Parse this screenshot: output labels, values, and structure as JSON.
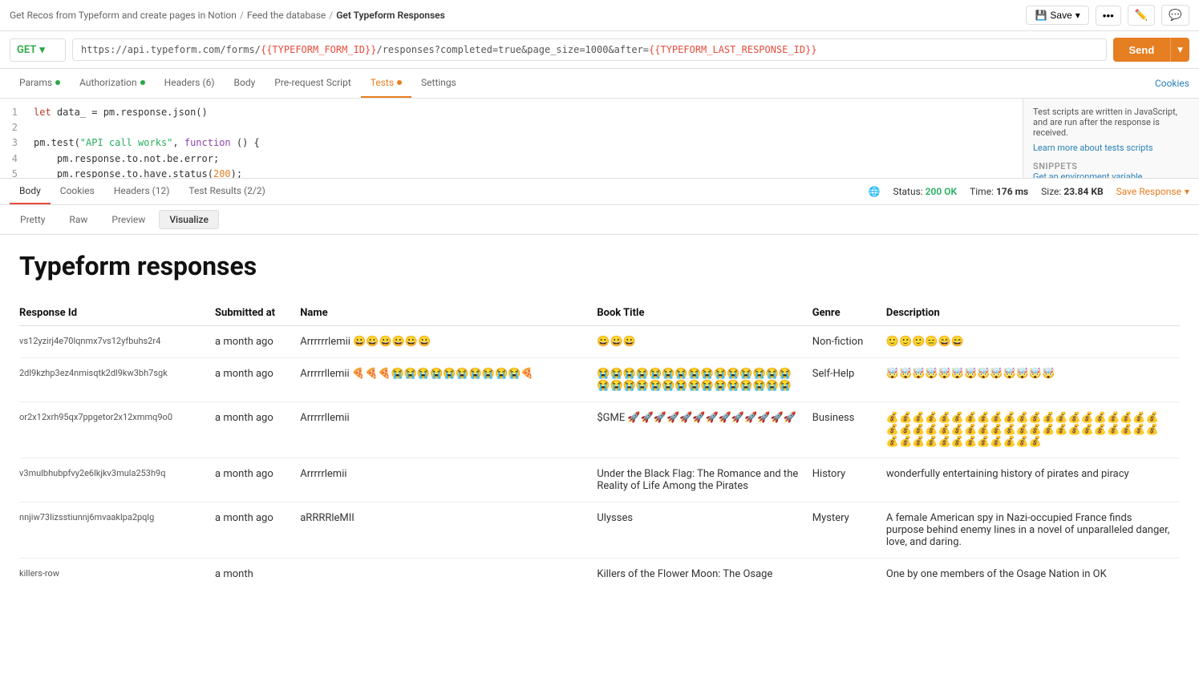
{
  "breadcrumb": {
    "part1": "Get Recos from Typeform and create pages in Notion",
    "sep1": "/",
    "part2": "Feed the database",
    "sep2": "/",
    "active": "Get Typeform Responses",
    "save_label": "Save",
    "dots_label": "•••"
  },
  "url_bar": {
    "method": "GET",
    "url": "https://api.typeform.com/forms/{{TYPEFORM_FORM_ID}}/responses?completed=true&page_size=1000&after={{TYPEFORM_LAST_RESPONSE_ID}}",
    "send_label": "Send"
  },
  "req_tabs": {
    "tabs": [
      {
        "label": "Params",
        "dot": true,
        "dot_color": "green",
        "active": false
      },
      {
        "label": "Authorization",
        "dot": true,
        "dot_color": "green",
        "active": false
      },
      {
        "label": "Headers (6)",
        "dot": false,
        "active": false
      },
      {
        "label": "Body",
        "dot": false,
        "active": false
      },
      {
        "label": "Pre-request Script",
        "dot": false,
        "active": false
      },
      {
        "label": "Tests",
        "dot": true,
        "dot_color": "orange",
        "active": true
      },
      {
        "label": "Settings",
        "dot": false,
        "active": false
      }
    ],
    "cookies_label": "Cookies"
  },
  "code": {
    "lines": [
      "1",
      "2",
      "3",
      "4",
      "5"
    ],
    "content": [
      "let data_ = pm.response.json()",
      "",
      "pm.test(\"API call works\", function () {",
      "    pm.response.to.not.be.error;",
      "    pm.response.to.have.status(200);"
    ],
    "right_panel": {
      "info": "Test scripts are written in JavaScript, and are run after the response is received.",
      "learn_more": "Learn more about tests scripts",
      "snippets_title": "SNIPPETS",
      "snippets_link": "Get an environment variable"
    }
  },
  "resp_tabs": {
    "tabs": [
      {
        "label": "Body",
        "active": true
      },
      {
        "label": "Cookies"
      },
      {
        "label": "Headers (12)"
      },
      {
        "label": "Test Results (2/2)"
      }
    ],
    "status": "200 OK",
    "time": "176 ms",
    "size": "23.84 KB",
    "save_response": "Save Response"
  },
  "body_tabs": {
    "tabs": [
      {
        "label": "Pretty"
      },
      {
        "label": "Raw"
      },
      {
        "label": "Preview"
      },
      {
        "label": "Visualize",
        "active": true
      }
    ]
  },
  "visualize": {
    "title": "Typeform responses",
    "columns": [
      "Response Id",
      "Submitted at",
      "Name",
      "Book Title",
      "Genre",
      "Description"
    ],
    "rows": [
      {
        "id": "vs12yzirj4e70lqnmx7vs12yfbuhs2r4",
        "submitted": "a month ago",
        "name": "Arrrrrrlemii 😀😀😀😀😀😀",
        "book_title": "😀😀😀",
        "genre": "Non-fiction",
        "description": "🙂🙂🙂😑😄😄"
      },
      {
        "id": "2dl9kzhp3ez4nmisqtk2dl9kw3bh7sgk",
        "submitted": "a month ago",
        "name": "Arrrrrllemii 🍕🍕🍕😭😭😭😭😭😭😭😭😭😭🍕",
        "book_title": "😭😭😭😭😭😭😭😭😭😭😭😭😭😭😭😭😭😭😭😭😭😭😭😭😭😭😭😭😭😭",
        "genre": "Self-Help",
        "description": "🤯🤯🤯🤯🤯🤯🤯🤯🤯🤯🤯🤯🤯"
      },
      {
        "id": "or2x12xrh95qx7ppgetor2x12xmmq9o0",
        "submitted": "a month ago",
        "name": "Arrrrrllemii",
        "book_title": "$GME 🚀🚀🚀🚀🚀🚀🚀🚀🚀🚀🚀🚀🚀",
        "genre": "Business",
        "description": "💰💰💰💰💰💰💰💰💰💰💰💰💰💰💰💰💰💰💰💰💰💰💰💰💰💰💰💰💰💰💰💰💰💰💰💰💰💰💰💰💰💰💰💰💰💰💰💰💰💰💰💰💰💰"
      },
      {
        "id": "v3mulbhubpfvy2e6lkjkv3mula253h9q",
        "submitted": "a month ago",
        "name": "Arrrrrlemii",
        "book_title": "Under the Black Flag: The Romance and the Reality of Life Among the Pirates",
        "genre": "History",
        "description": "wonderfully entertaining history of pirates and piracy"
      },
      {
        "id": "nnjiw73lizsstiunnj6mvaaklpa2pqlg",
        "submitted": "a month ago",
        "name": "aRRRRleMII",
        "book_title": "Ulysses",
        "genre": "Mystery",
        "description": "A female American spy in Nazi-occupied France finds purpose behind enemy lines in a novel of unparalleled danger, love, and daring."
      },
      {
        "id": "killers-row",
        "submitted": "a month",
        "name": "",
        "book_title": "Killers of the Flower Moon: The Osage",
        "genre": "",
        "description": "One by one members of the Osage Nation in OK"
      }
    ]
  }
}
